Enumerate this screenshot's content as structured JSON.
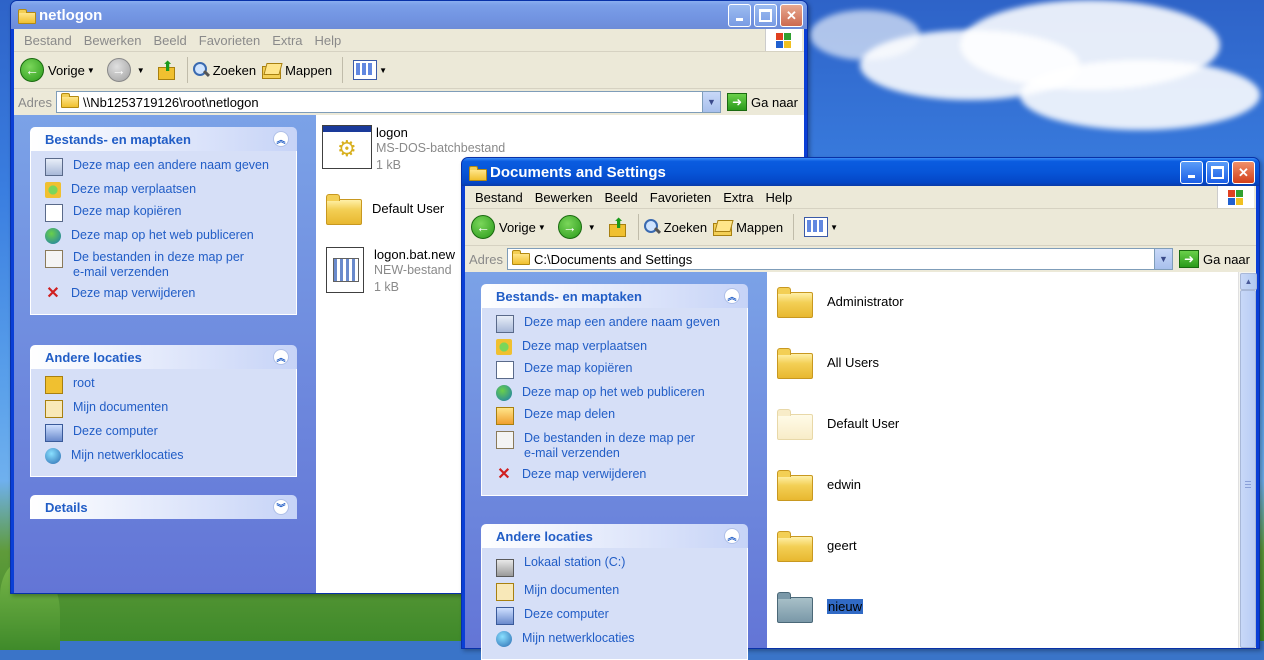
{
  "desktop": {
    "theme": "Bliss"
  },
  "window1": {
    "title": "netlogon",
    "menu": [
      "Bestand",
      "Bewerken",
      "Beeld",
      "Favorieten",
      "Extra",
      "Help"
    ],
    "toolbar": {
      "back": "Vorige",
      "search": "Zoeken",
      "folders": "Mappen"
    },
    "address": {
      "label": "Adres",
      "value": "\\\\Nb1253719126\\root\\netlogon",
      "go": "Ga naar"
    },
    "tasks": {
      "title": "Bestands- en maptaken",
      "items": [
        {
          "label": "Deze map een andere naam geven",
          "icon": "rename-icon"
        },
        {
          "label": "Deze map verplaatsen",
          "icon": "move-icon"
        },
        {
          "label": "Deze map kopiëren",
          "icon": "copy-icon"
        },
        {
          "label": "Deze map op het web publiceren",
          "icon": "web-publish-icon"
        },
        {
          "label": "De bestanden in deze map per",
          "label2": "e-mail verzenden",
          "icon": "email-icon"
        },
        {
          "label": "Deze map verwijderen",
          "icon": "delete-icon"
        }
      ]
    },
    "other": {
      "title": "Andere locaties",
      "items": [
        {
          "label": "root",
          "icon": "folder-icon"
        },
        {
          "label": "Mijn documenten",
          "icon": "my-documents-icon"
        },
        {
          "label": "Deze computer",
          "icon": "my-computer-icon"
        },
        {
          "label": "Mijn netwerklocaties",
          "icon": "network-places-icon"
        }
      ]
    },
    "details": {
      "title": "Details"
    },
    "files": [
      {
        "name": "logon",
        "type": "MS-DOS-batchbestand",
        "size": "1 kB",
        "icon": "batch-file-icon"
      },
      {
        "name": "Default User",
        "icon": "folder-icon"
      },
      {
        "name": "logon.bat.new",
        "type": "NEW-bestand",
        "size": "1 kB",
        "icon": "document-icon"
      }
    ]
  },
  "window2": {
    "title": "Documents and Settings",
    "menu": [
      "Bestand",
      "Bewerken",
      "Beeld",
      "Favorieten",
      "Extra",
      "Help"
    ],
    "toolbar": {
      "back": "Vorige",
      "search": "Zoeken",
      "folders": "Mappen"
    },
    "address": {
      "label": "Adres",
      "value": "C:\\Documents and Settings",
      "go": "Ga naar"
    },
    "tasks": {
      "title": "Bestands- en maptaken",
      "items": [
        {
          "label": "Deze map een andere naam geven",
          "icon": "rename-icon"
        },
        {
          "label": "Deze map verplaatsen",
          "icon": "move-icon"
        },
        {
          "label": "Deze map kopiëren",
          "icon": "copy-icon"
        },
        {
          "label": "Deze map op het web publiceren",
          "icon": "web-publish-icon"
        },
        {
          "label": "Deze map delen",
          "icon": "share-icon"
        },
        {
          "label": "De bestanden in deze map per",
          "label2": "e-mail verzenden",
          "icon": "email-icon"
        },
        {
          "label": "Deze map verwijderen",
          "icon": "delete-icon"
        }
      ]
    },
    "other": {
      "title": "Andere locaties",
      "items": [
        {
          "label": "Lokaal station (C:)",
          "icon": "local-drive-icon"
        },
        {
          "label": "Mijn documenten",
          "icon": "my-documents-icon"
        },
        {
          "label": "Deze computer",
          "icon": "my-computer-icon"
        },
        {
          "label": "Mijn netwerklocaties",
          "icon": "network-places-icon"
        }
      ]
    },
    "folders": [
      {
        "name": "Administrator"
      },
      {
        "name": "All Users"
      },
      {
        "name": "Default User"
      },
      {
        "name": "edwin"
      },
      {
        "name": "geert"
      },
      {
        "name": "nieuw"
      }
    ]
  },
  "colors": {
    "titlebar": "#0a5ce0",
    "taskpane": "#6375d6",
    "link": "#215dc6",
    "selection": "#316ac5"
  }
}
